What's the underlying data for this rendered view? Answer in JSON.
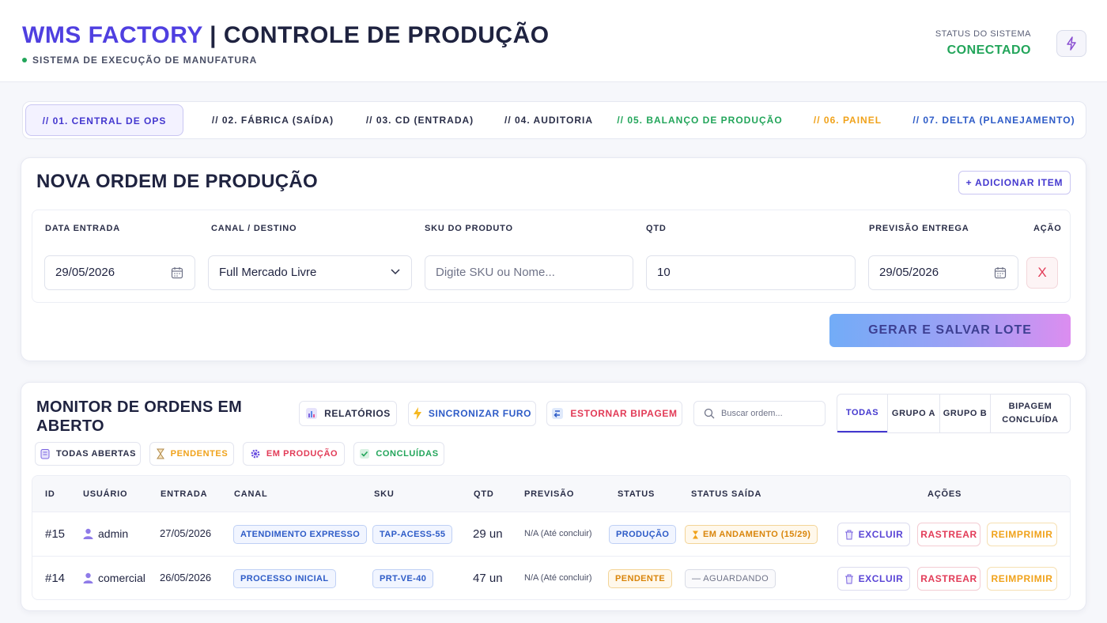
{
  "header": {
    "brand": "WMS FACTORY",
    "separator": "|",
    "title": "CONTROLE DE PRODUÇÃO",
    "subtitle": "SISTEMA DE EXECUÇÃO DE MANUFATURA",
    "status_label": "STATUS DO SISTEMA",
    "status_value": "CONECTADO",
    "status_color": "#22a55a",
    "action_icon": "bolt-icon"
  },
  "tabs": [
    {
      "label": "// 01. CENTRAL DE OPS",
      "color": "#4438cf",
      "active": true
    },
    {
      "label": "// 02. FÁBRICA (SAÍDA)",
      "color": "#2a2e48"
    },
    {
      "label": "// 03. CD (ENTRADA)",
      "color": "#2a2e48"
    },
    {
      "label": "// 04. AUDITORIA",
      "color": "#2a2e48"
    },
    {
      "label": "// 05. BALANÇO DE PRODUÇÃO",
      "color": "#22a55a"
    },
    {
      "label": "// 06. PAINEL",
      "color": "#f0a21a"
    },
    {
      "label": "// 07. DELTA (PLANEJAMENTO)",
      "color": "#2d5bc7"
    }
  ],
  "new_order": {
    "title": "NOVA ORDEM DE PRODUÇÃO",
    "add_item_label": "+ ADICIONAR ITEM",
    "labels": {
      "date_in": "DATA ENTRADA",
      "channel": "CANAL / DESTINO",
      "sku": "SKU DO PRODUTO",
      "qty": "QTD",
      "forecast": "PREVISÃO ENTREGA",
      "action": "AÇÃO"
    },
    "values": {
      "date_in": "29/05/2026",
      "channel": "Full Mercado Livre",
      "sku_placeholder": "Digite SKU ou Nome...",
      "qty": "10",
      "forecast": "29/05/2026",
      "remove": "X"
    },
    "generate_label": "GERAR E SALVAR LOTE"
  },
  "monitor": {
    "title": "MONITOR DE ORDENS EM ABERTO",
    "buttons": {
      "reports": "RELATÓRIOS",
      "sync": "SINCRONIZAR FURO",
      "reverse": "ESTORNAR BIPAGEM"
    },
    "search_placeholder": "Buscar ordem...",
    "segments": [
      "TODAS",
      "GRUPO A",
      "GRUPO B",
      "BIPAGEM CONCLUÍDA"
    ],
    "filters": [
      {
        "label": "TODAS ABERTAS",
        "color": "#2a2e48"
      },
      {
        "label": "PENDENTES",
        "color": "#f0a21a"
      },
      {
        "label": "EM PRODUÇÃO",
        "color": "#e23b57"
      },
      {
        "label": "CONCLUÍDAS",
        "color": "#22a55a"
      }
    ],
    "columns": [
      "ID",
      "USUÁRIO",
      "ENTRADA",
      "CANAL",
      "SKU",
      "QTD",
      "PREVISÃO",
      "STATUS",
      "STATUS SAÍDA",
      "AÇÕES"
    ],
    "rows": [
      {
        "id": "#15",
        "user": "admin",
        "date": "27/05/2026",
        "channel": "ATENDIMENTO EXPRESSO",
        "sku": "TAP-ACESS-55",
        "qty": "29 un",
        "forecast": "N/A (Até concluir)",
        "status": "PRODUÇÃO",
        "exit_status": "EM ANDAMENTO (15/29)"
      },
      {
        "id": "#14",
        "user": "comercial",
        "date": "26/05/2026",
        "channel": "PROCESSO INICIAL",
        "sku": "PRT-VE-40",
        "qty": "47 un",
        "forecast": "N/A (Até concluir)",
        "status": "PENDENTE",
        "exit_status": "— AGUARDANDO"
      }
    ],
    "row_actions": {
      "delete": "EXCLUIR",
      "track": "RASTREAR",
      "reprint": "REIMPRIMIR"
    }
  }
}
